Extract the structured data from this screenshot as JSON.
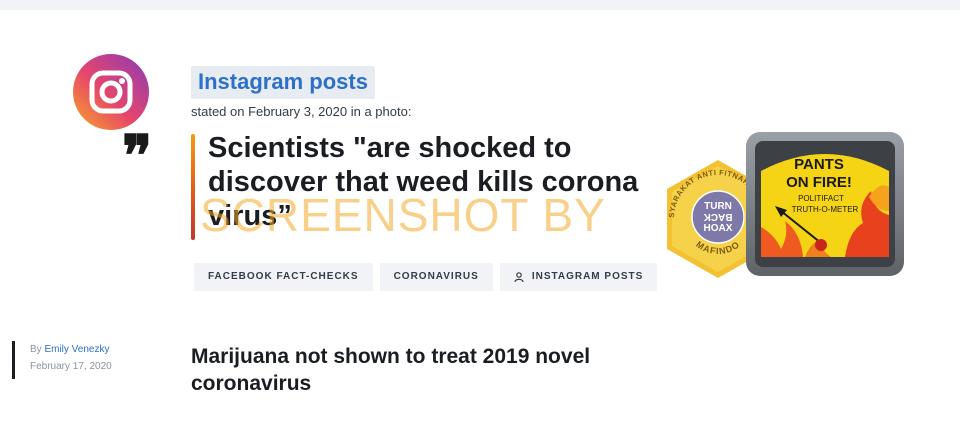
{
  "speaker": {
    "name": "Instagram posts",
    "stated": "stated on February 3, 2020 in a photo:"
  },
  "statement": "Scientists \"are shocked to discover that weed kills corona virus”",
  "watermark": "SCREENSHOT BY",
  "tags": [
    {
      "label": "FACEBOOK FACT-CHECKS",
      "icon": null
    },
    {
      "label": "CORONAVIRUS",
      "icon": null
    },
    {
      "label": "INSTAGRAM POSTS",
      "icon": "person-icon"
    }
  ],
  "mafindo_badge": {
    "ring_text": "MASYARAKAT ANTI FITNAH INDONESIA",
    "center_lines": [
      "TURN",
      "BACK",
      "HOAX"
    ],
    "bottom_text": "MAFINDO"
  },
  "ruling": {
    "label_line1": "PANTS",
    "label_line2": "ON FIRE!",
    "brand_line1": "POLITIFACT",
    "brand_line2": "TRUTH-O-METER"
  },
  "article": {
    "by_prefix": "By",
    "author": "Emily Venezky",
    "date": "February 17, 2020",
    "title": "Marijuana not shown to treat 2019 novel coronavirus"
  },
  "colors": {
    "accent_blue": "#2d70c9",
    "quote_bar_top": "#f39c12",
    "quote_bar_bottom": "#c0392b"
  }
}
